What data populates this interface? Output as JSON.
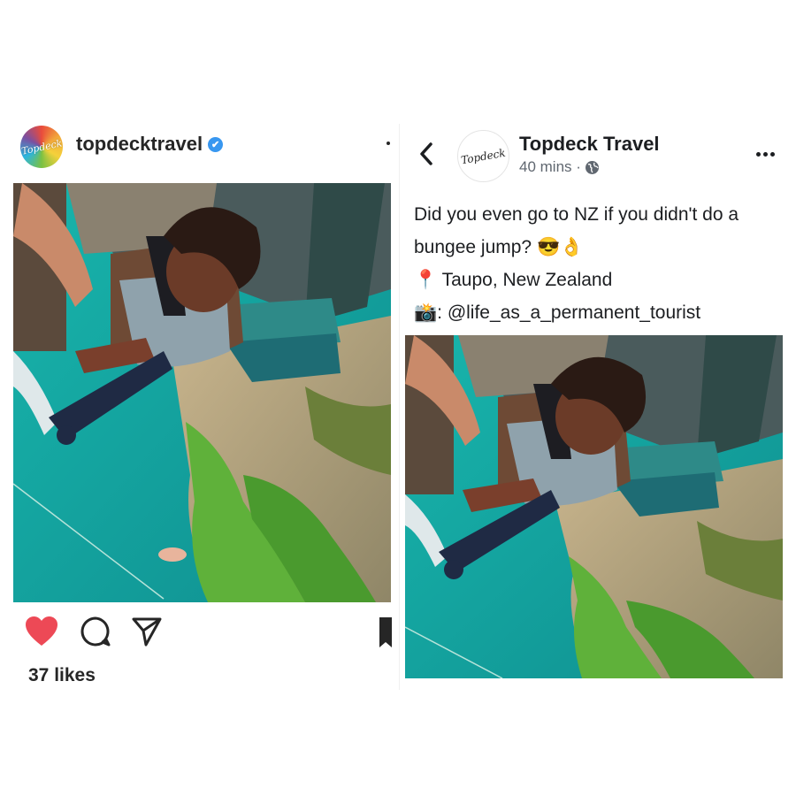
{
  "instagram": {
    "avatar_text": "Topdeck",
    "username": "topdecktravel",
    "verified_mark": "✔",
    "likes": "37 likes",
    "icons": {
      "heart": "heart-icon",
      "comment": "comment-icon",
      "share": "send-icon",
      "bookmark": "bookmark-icon"
    }
  },
  "facebook": {
    "avatar_text": "Topdeck",
    "page_name": "Topdeck Travel",
    "time": "40 mins ·",
    "caption_line1": "Did you even go to NZ if you didn't do a",
    "caption_line2": "bungee jump? 😎👌",
    "location_emoji": "📍",
    "location": "Taupo, New Zealand",
    "credit_emoji": "📸",
    "credit": ": @life_as_a_permanent_tourist"
  },
  "colors": {
    "heart": "#ed4956",
    "verified": "#3897f0",
    "fb_secondary": "#606770",
    "water": "#1aa3a0",
    "foliage": "#5fb13a"
  }
}
